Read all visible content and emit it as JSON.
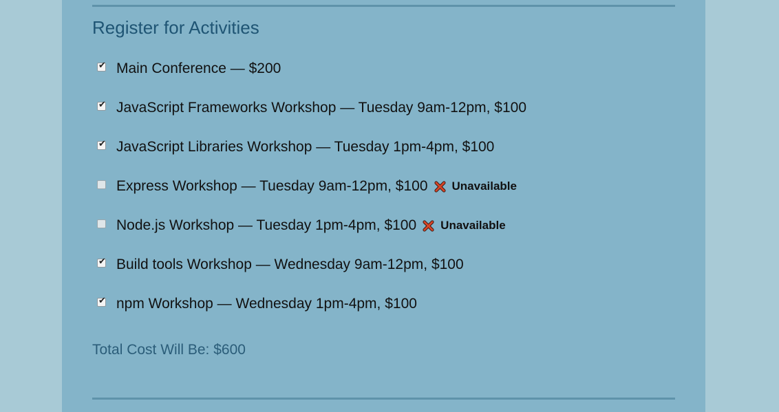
{
  "section": {
    "title": "Register for Activities",
    "total_label": "Total Cost Will Be: $600"
  },
  "activities": [
    {
      "label": "Main Conference — $200",
      "checked": true,
      "unavailable": false
    },
    {
      "label": "JavaScript Frameworks Workshop — Tuesday 9am-12pm, $100",
      "checked": true,
      "unavailable": false
    },
    {
      "label": "JavaScript Libraries Workshop — Tuesday 1pm-4pm, $100",
      "checked": true,
      "unavailable": false
    },
    {
      "label": "Express Workshop — Tuesday 9am-12pm, $100",
      "checked": false,
      "unavailable": true,
      "status": "Unavailable"
    },
    {
      "label": "Node.js Workshop — Tuesday 1pm-4pm, $100",
      "checked": false,
      "unavailable": true,
      "status": "Unavailable"
    },
    {
      "label": "Build tools Workshop — Wednesday 9am-12pm, $100",
      "checked": true,
      "unavailable": false
    },
    {
      "label": "npm Workshop — Wednesday 1pm-4pm, $100",
      "checked": true,
      "unavailable": false
    }
  ],
  "icons": {
    "checkbox_checked": "check-icon",
    "unavailable": "close-icon"
  },
  "colors": {
    "page_background": "#a8cad6",
    "panel_background": "#84b4c9",
    "heading": "#1f5574",
    "unavailable_x": "#d64528"
  }
}
